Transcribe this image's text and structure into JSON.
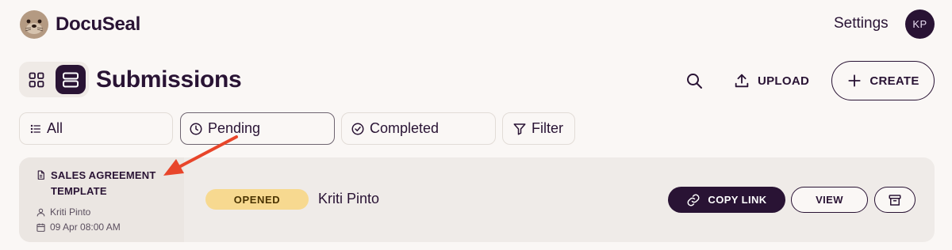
{
  "header": {
    "brand": "DocuSeal",
    "settings_label": "Settings",
    "avatar_initials": "KP"
  },
  "toolbar": {
    "title": "Submissions",
    "upload_label": "UPLOAD",
    "create_label": "CREATE",
    "active_view": "list"
  },
  "filters": {
    "all_label": "All",
    "pending_label": "Pending",
    "completed_label": "Completed",
    "filter_label": "Filter",
    "active": "Pending"
  },
  "submission": {
    "template_name": "SALES AGREEMENT TEMPLATE",
    "author": "Kriti Pinto",
    "date": "09 Apr 08:00 AM",
    "status": "OPENED",
    "submitter": "Kriti Pinto",
    "copy_link_label": "COPY LINK",
    "view_label": "VIEW"
  },
  "colors": {
    "primary": "#291334",
    "background": "#faf7f5",
    "status_opened": "#f7d990",
    "annotation_arrow": "#e8452a"
  }
}
